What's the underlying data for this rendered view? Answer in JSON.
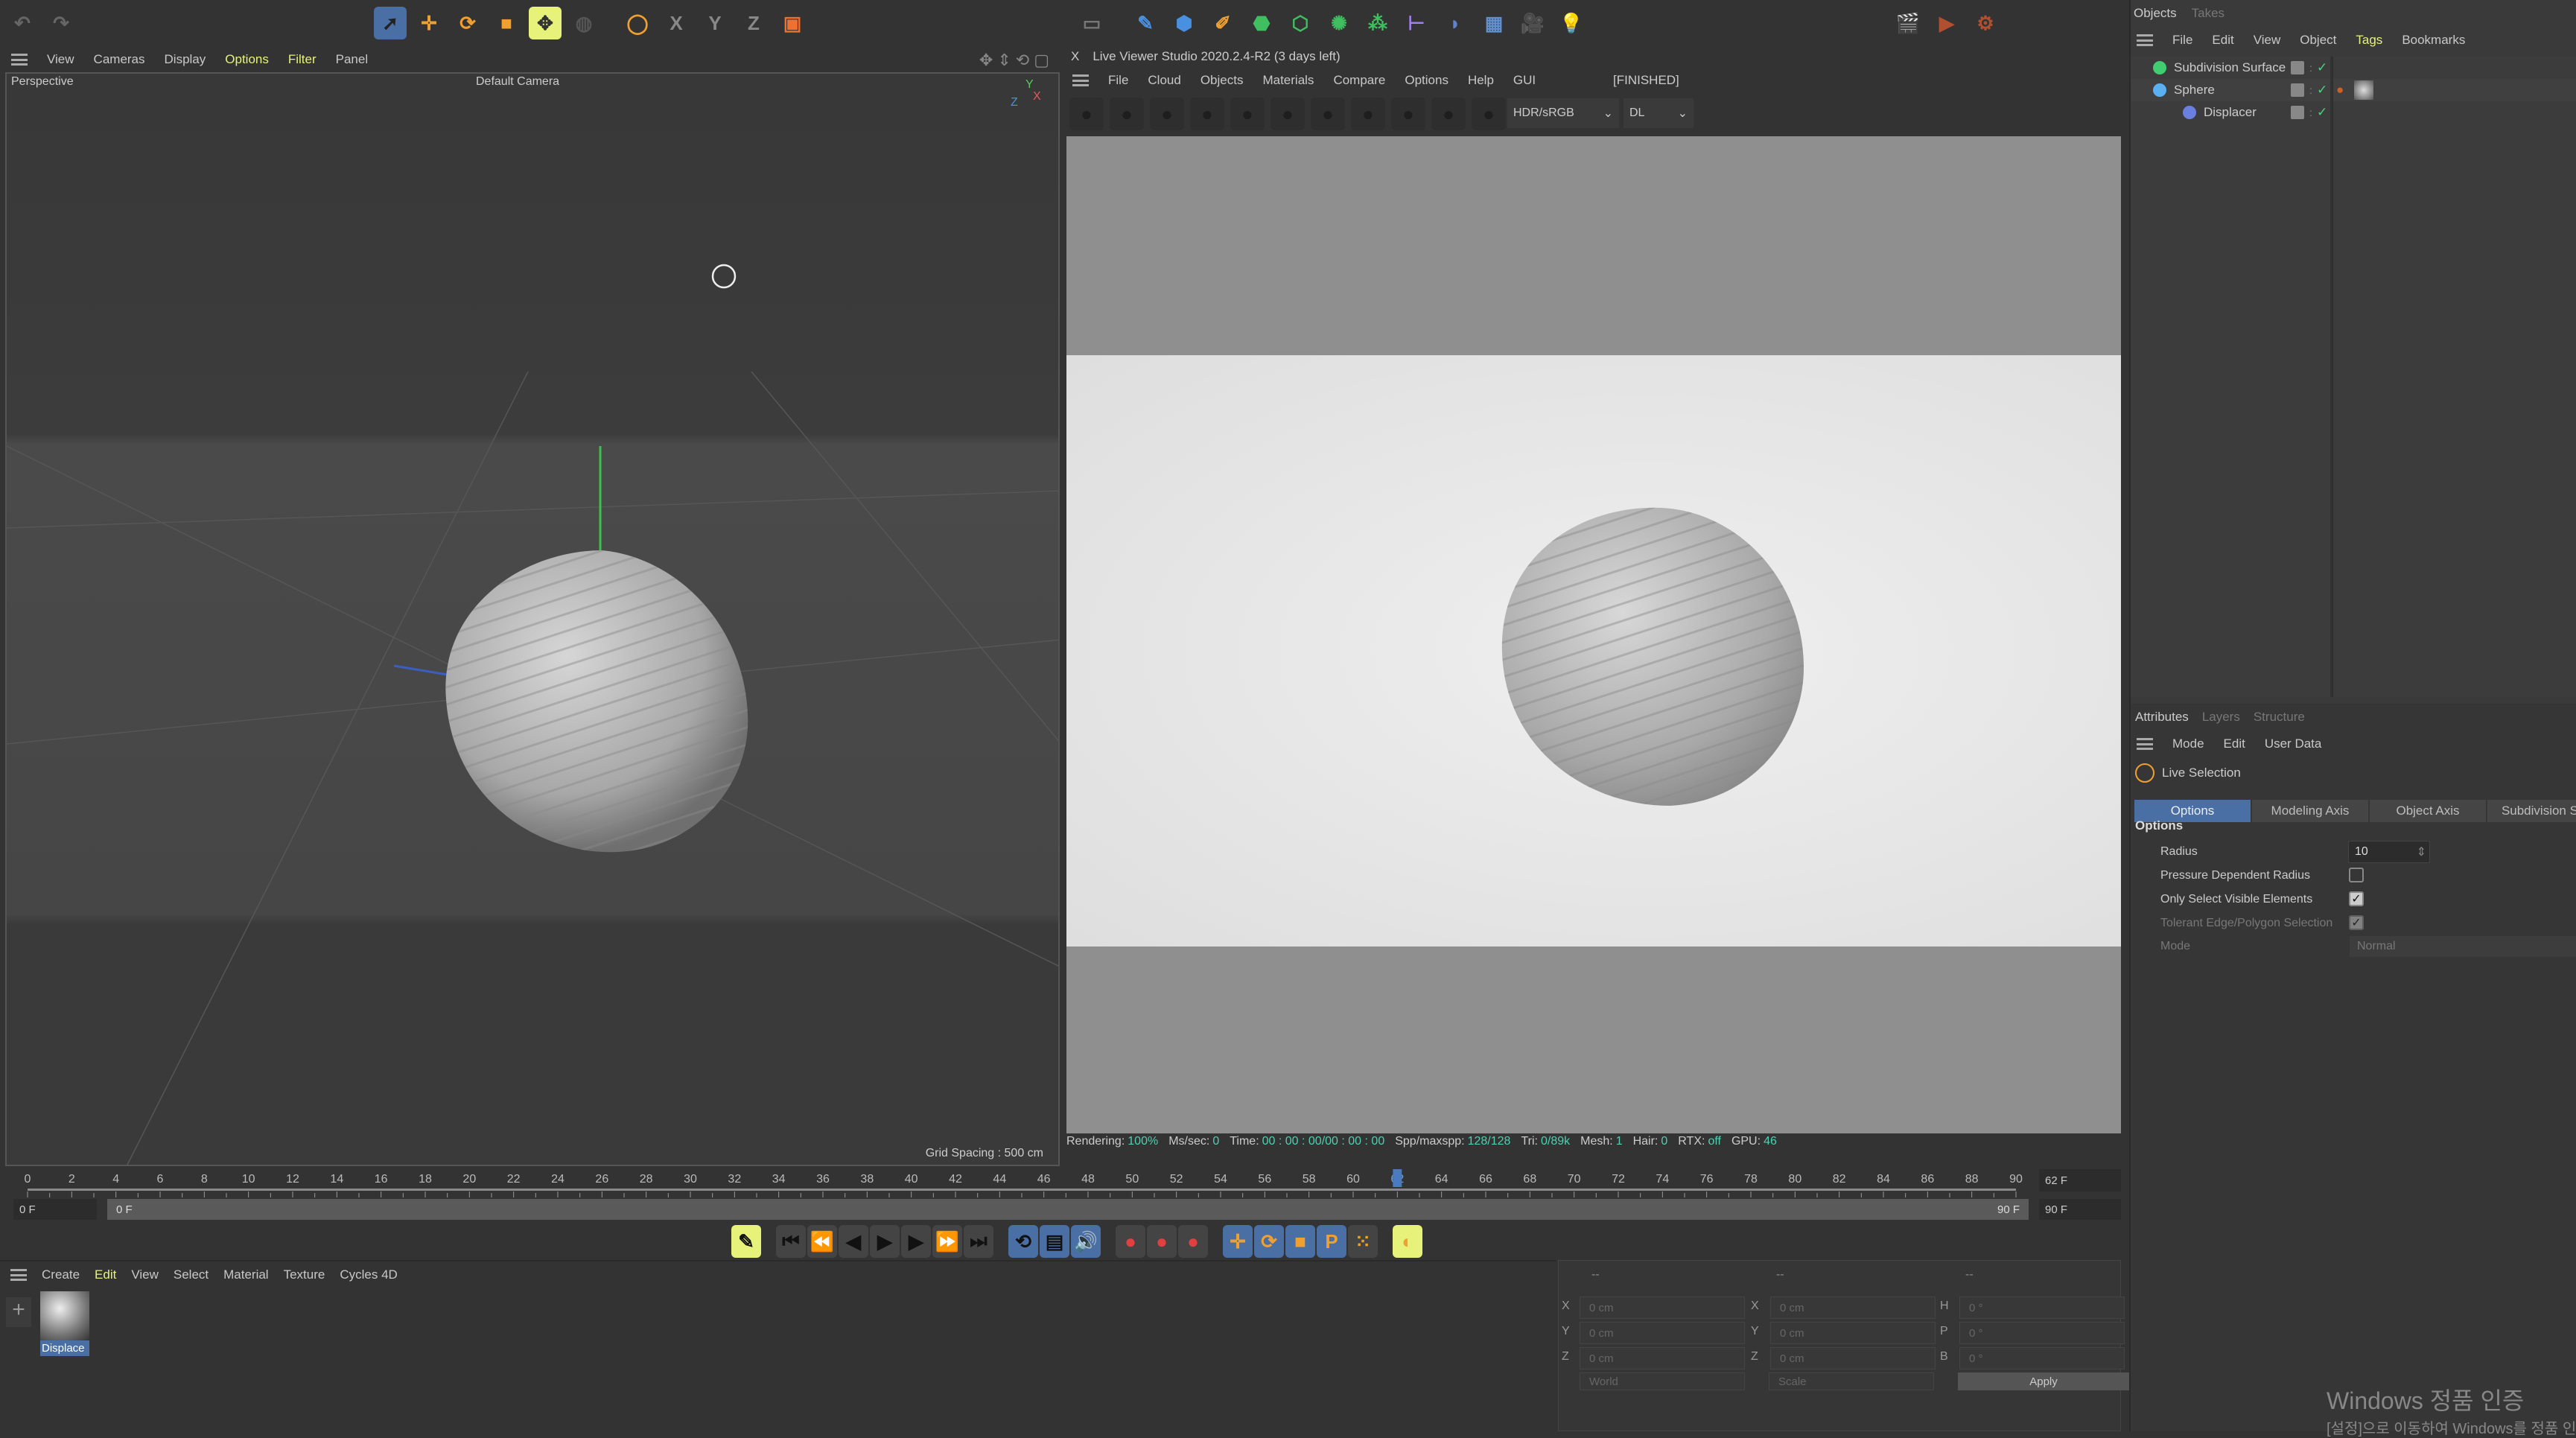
{
  "toolbar": {
    "icons": [
      {
        "name": "undo-icon",
        "c": "#666",
        "g": "↶"
      },
      {
        "name": "redo-icon",
        "c": "#666",
        "g": "↷"
      },
      {
        "name": "live-selection-icon",
        "c": "#4a7ac0",
        "g": "➚"
      },
      {
        "name": "move-icon",
        "c": "#f0a030",
        "g": "✛"
      },
      {
        "name": "rotate-icon",
        "c": "#f0a030",
        "g": "⟳"
      },
      {
        "name": "scale-icon",
        "c": "#f0a030",
        "g": "■"
      },
      {
        "name": "transform-icon",
        "c": "#e6f27a",
        "g": "✥"
      },
      {
        "name": "recent-tool-icon",
        "c": "#555",
        "g": "◍"
      },
      {
        "name": "world-coord-icon",
        "c": "#f0a030",
        "g": "◯"
      },
      {
        "name": "x-axis-lock-icon",
        "c": "#888",
        "g": "X"
      },
      {
        "name": "y-axis-lock-icon",
        "c": "#888",
        "g": "Y"
      },
      {
        "name": "z-axis-lock-icon",
        "c": "#888",
        "g": "Z"
      },
      {
        "name": "coordinate-system-icon",
        "c": "#f07030",
        "g": "▣"
      },
      {
        "name": "render-view-icon",
        "c": "#777",
        "g": "▭"
      },
      {
        "name": "spline-pen-icon",
        "c": "#4a90e0",
        "g": "✎"
      },
      {
        "name": "cube-icon",
        "c": "#4a90e0",
        "g": "⬢"
      },
      {
        "name": "pen-icon",
        "c": "#f0a030",
        "g": "✐"
      },
      {
        "name": "subdivision-icon",
        "c": "#3fbf60",
        "g": "⬣"
      },
      {
        "name": "extrude-icon",
        "c": "#3fbf60",
        "g": "⬡"
      },
      {
        "name": "cloner-icon",
        "c": "#3fbf60",
        "g": "✺"
      },
      {
        "name": "mograph-icon",
        "c": "#3fbf60",
        "g": "⁂"
      },
      {
        "name": "deformer-icon",
        "c": "#a080f0",
        "g": "⊢"
      },
      {
        "name": "field-icon",
        "c": "#6080d0",
        "g": "◗"
      },
      {
        "name": "floor-icon",
        "c": "#6090d0",
        "g": "▦"
      },
      {
        "name": "camera-icon",
        "c": "#ccc",
        "g": "🎥"
      },
      {
        "name": "light-icon",
        "c": "#ccc",
        "g": "💡"
      },
      {
        "name": "render-settings-icon",
        "c": "#b05030",
        "g": "🎬"
      },
      {
        "name": "render-icon",
        "c": "#b05030",
        "g": "▶"
      },
      {
        "name": "render-to-picture-viewer-icon",
        "c": "#b05030",
        "g": "⚙"
      }
    ]
  },
  "viewport": {
    "menu": [
      "View",
      "Cameras",
      "Display",
      "Options",
      "Filter",
      "Panel"
    ],
    "highlighted": [
      "Options",
      "Filter"
    ],
    "label": "Perspective",
    "camera": "Default Camera",
    "grid_spacing": "Grid Spacing : 500 cm",
    "axis": {
      "x": "X",
      "y": "Y",
      "z": "Z"
    }
  },
  "live_viewer": {
    "title": "Live Viewer Studio 2020.2.4-R2 (3 days left)",
    "close": "X",
    "menu": [
      "File",
      "Cloud",
      "Objects",
      "Materials",
      "Compare",
      "Options",
      "Help",
      "GUI"
    ],
    "state": "[FINISHED]",
    "color_space": "HDR/sRGB",
    "mode": "DL",
    "status": [
      {
        "k": "Rendering:",
        "v": "100%"
      },
      {
        "k": "Ms/sec:",
        "v": "0"
      },
      {
        "k": "Time:",
        "v": "00 : 00 : 00/00 : 00 : 00"
      },
      {
        "k": "Spp/maxspp:",
        "v": "128/128"
      },
      {
        "k": "Tri:",
        "v": "0/89k"
      },
      {
        "k": "Mesh:",
        "v": "1"
      },
      {
        "k": "Hair:",
        "v": "0"
      },
      {
        "k": "RTX:",
        "v": "off"
      },
      {
        "k": "GPU:",
        "v": "46"
      }
    ]
  },
  "objects": {
    "tabs": [
      "Objects",
      "Takes"
    ],
    "menu": [
      "File",
      "Edit",
      "View",
      "Object",
      "Tags",
      "Bookmarks"
    ],
    "highlighted": "Tags",
    "items": [
      {
        "name": "Subdivision Surface",
        "icon": "subdivision-surface-icon",
        "color": "#3fcf70",
        "indent": 0
      },
      {
        "name": "Sphere",
        "icon": "sphere-icon",
        "color": "#5ab0f0",
        "indent": 0
      },
      {
        "name": "Displacer",
        "icon": "displacer-icon",
        "color": "#6a80e0",
        "indent": 1
      }
    ]
  },
  "attributes": {
    "tabs": [
      "Attributes",
      "Layers",
      "Structure"
    ],
    "menu": [
      "Mode",
      "Edit",
      "User Data"
    ],
    "tool": "Live Selection",
    "subtabs": [
      "Options",
      "Modeling Axis",
      "Object Axis",
      "Subdivision Sur"
    ],
    "active_subtab": "Options",
    "section": "Options",
    "radius_label": "Radius",
    "radius": "10",
    "pressure_label": "Pressure Dependent Radius",
    "pressure": false,
    "visible_label": "Only Select Visible Elements",
    "visible": true,
    "tolerant_label": "Tolerant Edge/Polygon Selection",
    "tolerant": true,
    "mode_label": "Mode",
    "mode": "Normal"
  },
  "timeline": {
    "start": 0,
    "end": 90,
    "step": 2,
    "current": 62,
    "current_label": "62 F",
    "min_field": "0 F",
    "range_start": "0 F",
    "range_end": "90 F",
    "max_field": "90 F"
  },
  "playback": {
    "icons": [
      "keyframe-record-icon",
      "go-to-start-icon",
      "previous-key-icon",
      "previous-frame-icon",
      "play-icon",
      "next-frame-icon",
      "next-key-icon",
      "go-to-end-icon",
      "loop-icon",
      "timeline-icon",
      "sound-icon",
      "autokey-icon",
      "record-active-icon",
      "record-keyframe-icon",
      "key-position-icon",
      "key-rotation-icon",
      "key-scale-icon",
      "key-param-icon",
      "key-pla-icon",
      "scheme-icon"
    ]
  },
  "materials": {
    "menu": [
      "Create",
      "Edit",
      "View",
      "Select",
      "Material",
      "Texture",
      "Cycles 4D"
    ],
    "highlighted": "Edit",
    "items": [
      {
        "name": "Displace"
      }
    ]
  },
  "coordinates": {
    "headers": [
      "--",
      "--",
      "--"
    ],
    "rows": [
      {
        "a": "X",
        "av": "0 cm",
        "b": "X",
        "bv": "0 cm",
        "c": "H",
        "cv": "0 °"
      },
      {
        "a": "Y",
        "av": "0 cm",
        "b": "Y",
        "bv": "0 cm",
        "c": "P",
        "cv": "0 °"
      },
      {
        "a": "Z",
        "av": "0 cm",
        "b": "Z",
        "bv": "0 cm",
        "c": "B",
        "cv": "0 °"
      }
    ],
    "space": "World",
    "mode": "Scale",
    "apply": "Apply"
  },
  "watermark": {
    "title": "Windows 정품 인증",
    "sub": "[설정]으로 이동하여 Windows를 정품 인증합니다."
  }
}
